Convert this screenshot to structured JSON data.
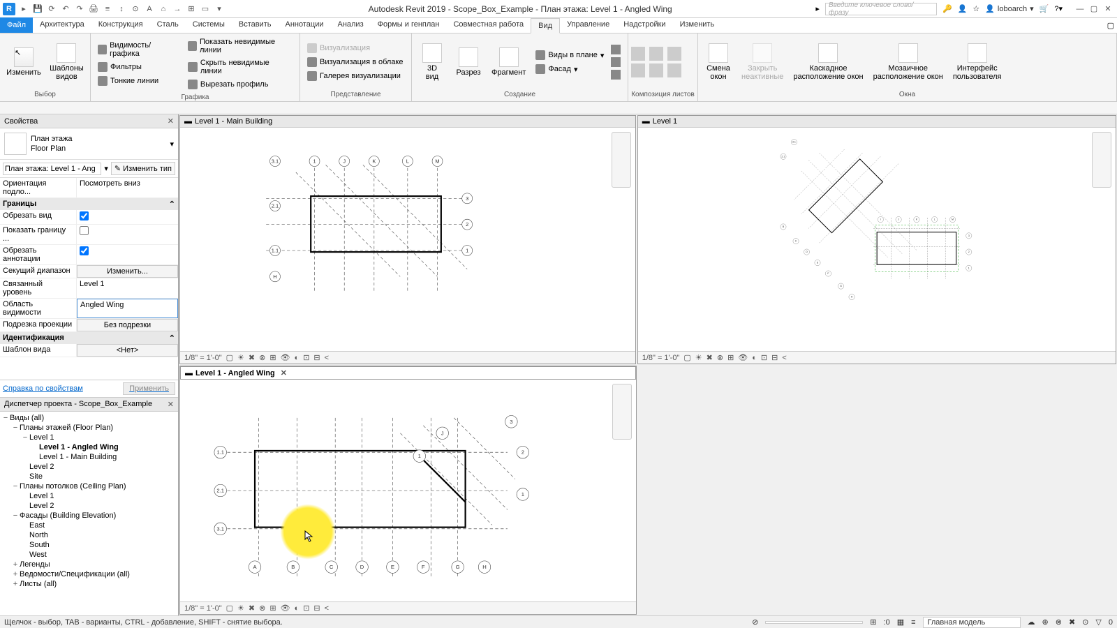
{
  "title": "Autodesk Revit 2019 - Scope_Box_Example - План этажа: Level 1 - Angled Wing",
  "search_placeholder": "Введите ключевое слово/фразу",
  "user": "loboarch",
  "file_tab": "Файл",
  "tabs": [
    "Архитектура",
    "Конструкция",
    "Сталь",
    "Системы",
    "Вставить",
    "Аннотации",
    "Анализ",
    "Формы и генплан",
    "Совместная работа",
    "Вид",
    "Управление",
    "Надстройки",
    "Изменить"
  ],
  "active_tab": 9,
  "ribbon": {
    "select": {
      "btn": "Изменить",
      "tmpl": "Шаблоны\nвидов",
      "label": "Выбор"
    },
    "graphics": {
      "items": [
        "Видимость/ графика",
        "Фильтры",
        "Тонкие линии",
        "Показать невидимые линии",
        "Скрыть невидимые линии",
        "Вырезать профиль"
      ],
      "label": "Графика"
    },
    "present": {
      "items": [
        "Визуализация",
        "Визуализация в облаке",
        "Галерея визуализации"
      ],
      "label": "Представление"
    },
    "create": {
      "btns": [
        "3D\nвид",
        "Разрез",
        "Фрагмент"
      ],
      "drops": [
        "Виды в плане",
        "Фасад"
      ],
      "label": "Создание"
    },
    "sheets": {
      "label": "Композиция листов"
    },
    "windows": {
      "btns": [
        "Смена\nокон",
        "Закрыть\nнеактивные",
        "Каскадное\nрасположение окон",
        "Мозаичное\nрасположение окон",
        "Интерфейс\nпользователя"
      ],
      "label": "Окна"
    }
  },
  "props": {
    "title": "Свойства",
    "type_family": "План этажа",
    "type_name": "Floor Plan",
    "instance": "План этажа: Level 1 - Ang",
    "edit_type": "Изменить тип",
    "rows": [
      {
        "k": "Ориентация подло...",
        "v": "Посмотреть вниз"
      },
      {
        "cat": "Границы"
      },
      {
        "k": "Обрезать вид",
        "cb": true
      },
      {
        "k": "Показать границу ...",
        "cb": false
      },
      {
        "k": "Обрезать аннотации",
        "cb": true
      },
      {
        "k": "Секущий диапазон",
        "btn": "Изменить..."
      },
      {
        "k": "Связанный уровень",
        "v": "Level 1"
      },
      {
        "k": "Область видимости",
        "v": "Angled Wing",
        "hl": true
      },
      {
        "k": "Подрезка проекции",
        "btn": "Без подрезки"
      },
      {
        "cat": "Идентификация"
      },
      {
        "k": "Шаблон вида",
        "btn": "<Нет>"
      }
    ],
    "help": "Справка по свойствам",
    "apply": "Применить"
  },
  "browser": {
    "title": "Диспетчер проекта - Scope_Box_Example",
    "items": [
      {
        "d": 1,
        "tw": "−",
        "t": "Виды (all)"
      },
      {
        "d": 2,
        "tw": "−",
        "t": "Планы этажей (Floor Plan)"
      },
      {
        "d": 3,
        "tw": "−",
        "t": "Level 1"
      },
      {
        "d": 4,
        "t": "Level 1 - Angled Wing",
        "bold": true
      },
      {
        "d": 4,
        "t": "Level 1 - Main Building"
      },
      {
        "d": 3,
        "t": "Level 2"
      },
      {
        "d": 3,
        "t": "Site"
      },
      {
        "d": 2,
        "tw": "−",
        "t": "Планы потолков (Ceiling Plan)"
      },
      {
        "d": 3,
        "t": "Level 1"
      },
      {
        "d": 3,
        "t": "Level 2"
      },
      {
        "d": 2,
        "tw": "−",
        "t": "Фасады (Building Elevation)"
      },
      {
        "d": 3,
        "t": "East"
      },
      {
        "d": 3,
        "t": "North"
      },
      {
        "d": 3,
        "t": "South"
      },
      {
        "d": 3,
        "t": "West"
      },
      {
        "d": 2,
        "tw": "+",
        "t": "Легенды"
      },
      {
        "d": 2,
        "tw": "+",
        "t": "Ведомости/Спецификации (all)"
      },
      {
        "d": 2,
        "tw": "+",
        "t": "Листы (all)"
      }
    ]
  },
  "views": {
    "v1": "Level 1 - Main Building",
    "v2": "Level 1 - Angled Wing",
    "v3": "Level 1",
    "scale": "1/8\" = 1'-0\""
  },
  "status": {
    "hint": "Щелчок - выбор, TAB - варианты, CTRL - добавление, SHIFT - снятие выбора.",
    "zero": ":0",
    "model": "Главная модель"
  }
}
